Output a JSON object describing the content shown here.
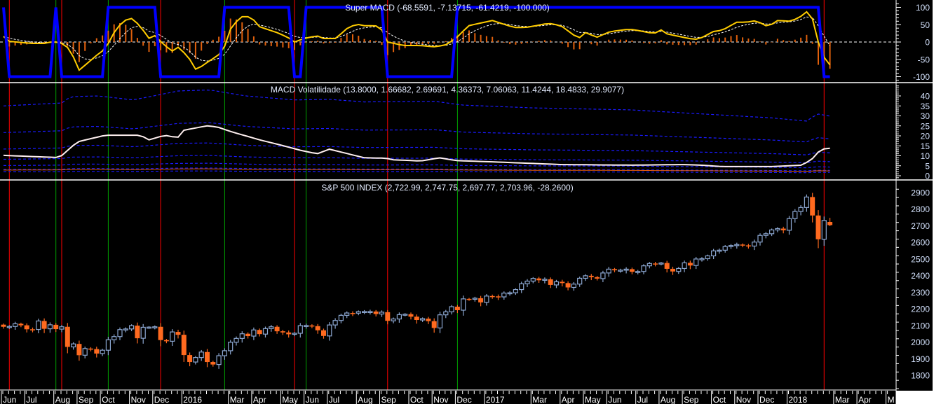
{
  "chart_data": [
    {
      "type": "line",
      "panel": "super-macd",
      "title": "Super MACD (-68.5591, -7.13715, -61.4219, -100.000)",
      "ylim": [
        -100,
        100
      ],
      "yticks": [
        100,
        50,
        0,
        -50,
        -100
      ],
      "colors": {
        "signal_step": "#0000ff",
        "macd": "#ffcc00",
        "trigger": "#ffffff",
        "histogram": "#e0600c",
        "zero": "#ffffff"
      },
      "signal_segments": [
        [
          0,
          0,
          100
        ],
        [
          1,
          8,
          -100
        ],
        [
          9,
          9,
          100
        ],
        [
          10,
          17,
          -100
        ],
        [
          18,
          26,
          100
        ],
        [
          27,
          37,
          -100
        ],
        [
          38,
          49,
          100
        ],
        [
          50,
          51,
          -100
        ],
        [
          52,
          65,
          100
        ],
        [
          66,
          77,
          -100
        ],
        [
          78,
          140,
          100
        ],
        [
          141,
          142,
          -100
        ]
      ],
      "macd_keypoints": [
        [
          0,
          16
        ],
        [
          1,
          2
        ],
        [
          4.8,
          -4
        ],
        [
          7.2,
          -4
        ],
        [
          8.1,
          0
        ],
        [
          9.6,
          0
        ],
        [
          11.4,
          -20
        ],
        [
          13,
          -81
        ],
        [
          14.5,
          -60
        ],
        [
          16.3,
          -34
        ],
        [
          17.5,
          -20
        ],
        [
          19,
          27
        ],
        [
          20.5,
          60
        ],
        [
          21.9,
          69
        ],
        [
          23.5,
          47
        ],
        [
          24.9,
          10
        ],
        [
          25.9,
          20
        ],
        [
          27.1,
          0
        ],
        [
          28.9,
          -27
        ],
        [
          30.1,
          -14
        ],
        [
          31.9,
          -47
        ],
        [
          33.1,
          -81
        ],
        [
          34.9,
          -60
        ],
        [
          36.7,
          -40
        ],
        [
          37.7,
          -27
        ],
        [
          39.2,
          47
        ],
        [
          41,
          73
        ],
        [
          42.5,
          73
        ],
        [
          44,
          44
        ],
        [
          47,
          27
        ],
        [
          48.8,
          14
        ],
        [
          50,
          0
        ],
        [
          51.6,
          10
        ],
        [
          53.9,
          18
        ],
        [
          54.8,
          10
        ],
        [
          57.2,
          10
        ],
        [
          58.7,
          36
        ],
        [
          60.6,
          52
        ],
        [
          62,
          47
        ],
        [
          63.9,
          47
        ],
        [
          64.8,
          42
        ],
        [
          66,
          0
        ],
        [
          68.7,
          -10
        ],
        [
          71.7,
          -10
        ],
        [
          73.9,
          -14
        ],
        [
          75.9,
          -9
        ],
        [
          77.7,
          10
        ],
        [
          79.9,
          47
        ],
        [
          84,
          62
        ],
        [
          87.7,
          42
        ],
        [
          89.8,
          42
        ],
        [
          93.7,
          54
        ],
        [
          95.8,
          47
        ],
        [
          98.8,
          10
        ],
        [
          100,
          27
        ],
        [
          102,
          14
        ],
        [
          104.2,
          30
        ],
        [
          107,
          36
        ],
        [
          108.2,
          36
        ],
        [
          111.8,
          24
        ],
        [
          112.9,
          36
        ],
        [
          113.9,
          24
        ],
        [
          117.8,
          10
        ],
        [
          119,
          8
        ],
        [
          120.2,
          14
        ],
        [
          121.9,
          30
        ],
        [
          123.5,
          34
        ],
        [
          126,
          57
        ],
        [
          127.5,
          57
        ],
        [
          129.5,
          62
        ],
        [
          130.7,
          47
        ],
        [
          131.7,
          47
        ],
        [
          132.8,
          62
        ],
        [
          135.2,
          60
        ],
        [
          136.7,
          70
        ],
        [
          138,
          87
        ],
        [
          138.8,
          80
        ],
        [
          140,
          0
        ],
        [
          141,
          -44
        ],
        [
          142,
          -66
        ]
      ]
    },
    {
      "type": "line",
      "panel": "macd-volatility",
      "title": "MACD Volatilidade (13.8000, 1.66682, 2.69691, 4.36373, 7.06063, 11.4244, 18.4833, 29.9077)",
      "ylim": [
        0,
        45
      ],
      "yticks": [
        40,
        35,
        30,
        25,
        20,
        15,
        10,
        5,
        0
      ],
      "colors": {
        "volatility": "#fff0f0",
        "bands": "#1a1aff",
        "base": "#e05a10"
      },
      "band_ratio": 1.618,
      "band_count": 7,
      "volatility_keypoints": [
        [
          0,
          10.2
        ],
        [
          9.6,
          9.1
        ],
        [
          12.7,
          17
        ],
        [
          17.5,
          20.3
        ],
        [
          23.5,
          20.3
        ],
        [
          25,
          18
        ],
        [
          27.7,
          20.3
        ],
        [
          29.9,
          19
        ],
        [
          31,
          22.8
        ],
        [
          34.9,
          25
        ],
        [
          36.7,
          24.5
        ],
        [
          39.2,
          22
        ],
        [
          44,
          18
        ],
        [
          47.6,
          15.4
        ],
        [
          51.2,
          12.6
        ],
        [
          53.9,
          11
        ],
        [
          56,
          13.3
        ],
        [
          62,
          9
        ],
        [
          65.7,
          8.8
        ],
        [
          66.9,
          8
        ],
        [
          71.7,
          7.4
        ],
        [
          74.9,
          9
        ],
        [
          77.7,
          7.6
        ],
        [
          83.7,
          7
        ],
        [
          89.8,
          6.3
        ],
        [
          95.8,
          5.6
        ],
        [
          107.8,
          5.3
        ],
        [
          116.9,
          5.6
        ],
        [
          119.9,
          5.3
        ],
        [
          123.5,
          4.6
        ],
        [
          131.9,
          4.6
        ],
        [
          137.3,
          5.3
        ],
        [
          139.2,
          9
        ],
        [
          140.4,
          13.3
        ],
        [
          142,
          13.8
        ]
      ],
      "top_band_keypoints": [
        [
          0,
          35
        ],
        [
          10.2,
          36.5
        ],
        [
          11.4,
          39.6
        ],
        [
          16.3,
          40
        ],
        [
          22.3,
          38
        ],
        [
          30.1,
          42.5
        ],
        [
          35.5,
          43
        ],
        [
          41.6,
          40
        ],
        [
          50,
          38
        ],
        [
          56,
          38.3
        ],
        [
          62,
          37
        ],
        [
          74.1,
          37.3
        ],
        [
          78.9,
          35.4
        ],
        [
          91,
          34
        ],
        [
          107.8,
          33
        ],
        [
          119.9,
          31
        ],
        [
          131.9,
          29
        ],
        [
          138,
          27.4
        ],
        [
          139.8,
          31
        ],
        [
          142,
          29.9
        ]
      ]
    },
    {
      "type": "candlestick",
      "panel": "price",
      "title": "S&P 500 INDEX (2,722.99, 2,747.75, 2,697.77, 2,703.96, -28.2600)",
      "ylim": [
        1720,
        2940
      ],
      "yticks": [
        2900,
        2800,
        2700,
        2600,
        2500,
        2400,
        2300,
        2200,
        2100,
        2000,
        1900,
        1800
      ],
      "colors": {
        "up": "#8ba6d0",
        "down": "#ff6a1f"
      },
      "first_open": 2105,
      "last_candle": {
        "open": 2722.99,
        "high": 2747.75,
        "low": 2697.77,
        "close": 2703.96
      },
      "weekly_closes": [
        2092,
        2094,
        2110,
        2101,
        2077,
        2076,
        2127,
        2080,
        2104,
        2078,
        2092,
        1971,
        1989,
        1921,
        1961,
        1958,
        1931,
        1951,
        2014,
        2033,
        2075,
        2079,
        2099,
        2023,
        2089,
        2090,
        2092,
        2012,
        2005,
        2061,
        2044,
        1922,
        1880,
        1907,
        1940,
        1880,
        1865,
        1918,
        1948,
        1999,
        2022,
        2050,
        2036,
        2073,
        2048,
        2081,
        2092,
        2065,
        2058,
        2047,
        2053,
        2099,
        2100,
        2096,
        2071,
        2037,
        2103,
        2130,
        2161,
        2175,
        2174,
        2183,
        2184,
        2184,
        2169,
        2180,
        2128,
        2139,
        2165,
        2168,
        2153,
        2133,
        2141,
        2126,
        2085,
        2164,
        2182,
        2213,
        2192,
        2260,
        2258,
        2264,
        2239,
        2277,
        2275,
        2272,
        2295,
        2297,
        2316,
        2351,
        2367,
        2383,
        2372,
        2378,
        2344,
        2363,
        2355,
        2329,
        2349,
        2384,
        2399,
        2391,
        2382,
        2416,
        2439,
        2432,
        2433,
        2439,
        2423,
        2425,
        2459,
        2473,
        2472,
        2476,
        2441,
        2425,
        2443,
        2477,
        2461,
        2500,
        2502,
        2519,
        2549,
        2553,
        2575,
        2581,
        2587,
        2582,
        2578,
        2602,
        2642,
        2652,
        2675,
        2683,
        2673,
        2743,
        2786,
        2810,
        2873,
        2762,
        2619,
        2732,
        2704
      ]
    }
  ],
  "signal_lines": [
    {
      "week": 1,
      "type": "sell",
      "color": "#ff0000"
    },
    {
      "week": 9,
      "type": "buy",
      "color": "#00a000"
    },
    {
      "week": 10,
      "type": "sell",
      "color": "#ff0000"
    },
    {
      "week": 18,
      "type": "buy",
      "color": "#00a000"
    },
    {
      "week": 27,
      "type": "sell",
      "color": "#ff0000"
    },
    {
      "week": 38,
      "type": "buy",
      "color": "#00a000"
    },
    {
      "week": 50,
      "type": "sell",
      "color": "#ff0000"
    },
    {
      "week": 52,
      "type": "buy",
      "color": "#00a000"
    },
    {
      "week": 66,
      "type": "sell",
      "color": "#ff0000"
    },
    {
      "week": 78,
      "type": "buy",
      "color": "#00a000"
    },
    {
      "week": 141,
      "type": "sell",
      "color": "#ff0000"
    }
  ],
  "x_axis": {
    "months": [
      {
        "label": "Jun",
        "week": 0
      },
      {
        "label": "Jul",
        "week": 4
      },
      {
        "label": "Aug",
        "week": 9
      },
      {
        "label": "Sep",
        "week": 13
      },
      {
        "label": "Oct",
        "week": 17
      },
      {
        "label": "Nov",
        "week": 22
      },
      {
        "label": "Dec",
        "week": 26
      },
      {
        "label": "2016",
        "week": 31
      },
      {
        "label": "Mar",
        "week": 39
      },
      {
        "label": "Apr",
        "week": 43
      },
      {
        "label": "May",
        "week": 48
      },
      {
        "label": "Jun",
        "week": 52
      },
      {
        "label": "Jul",
        "week": 56
      },
      {
        "label": "Aug",
        "week": 61
      },
      {
        "label": "Sep",
        "week": 65
      },
      {
        "label": "Oct",
        "week": 70
      },
      {
        "label": "Nov",
        "week": 74
      },
      {
        "label": "Dec",
        "week": 78
      },
      {
        "label": "2017",
        "week": 83
      },
      {
        "label": "Mar",
        "week": 91
      },
      {
        "label": "Apr",
        "week": 96
      },
      {
        "label": "May",
        "week": 100
      },
      {
        "label": "Jun",
        "week": 104
      },
      {
        "label": "Jul",
        "week": 109
      },
      {
        "label": "Aug",
        "week": 113
      },
      {
        "label": "Sep",
        "week": 117
      },
      {
        "label": "Oct",
        "week": 122
      },
      {
        "label": "Nov",
        "week": 126
      },
      {
        "label": "Dec",
        "week": 130
      },
      {
        "label": "2018",
        "week": 135
      },
      {
        "label": "Mar",
        "week": 143
      },
      {
        "label": "Apr",
        "week": 147
      },
      {
        "label": "M",
        "week": 152
      }
    ],
    "total_weeks": 153
  }
}
